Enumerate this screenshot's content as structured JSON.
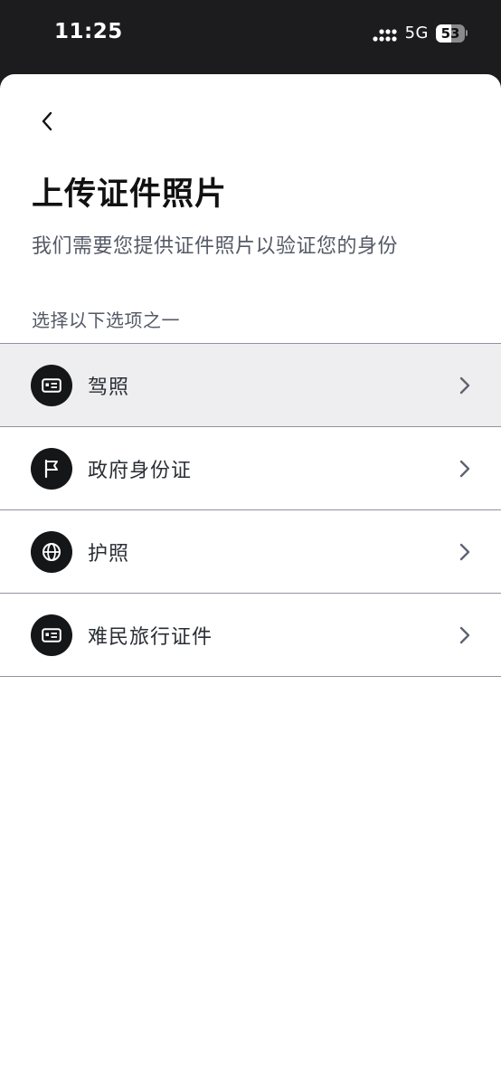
{
  "status_bar": {
    "time": "11:25",
    "network": "5G",
    "battery_level": "53",
    "icons": [
      "signal-icon",
      "battery-icon"
    ]
  },
  "header": {
    "back_icon": "chevron-left-icon",
    "title": "上传证件照片",
    "subtitle": "我们需要您提供证件照片以验证您的身份"
  },
  "options": {
    "section_label": "选择以下选项之一",
    "items": [
      {
        "label": "驾照",
        "icon": "id-card-icon",
        "selected": true
      },
      {
        "label": "政府身份证",
        "icon": "flag-icon",
        "selected": false
      },
      {
        "label": "护照",
        "icon": "globe-icon",
        "selected": false
      },
      {
        "label": "难民旅行证件",
        "icon": "id-card-icon",
        "selected": false
      }
    ],
    "chevron_icon": "chevron-right-icon"
  },
  "colors": {
    "status_bar_bg": "#1c1c1e",
    "title": "#111111",
    "secondary_text": "#545a66",
    "icon_circle": "#141618",
    "divider": "#8f93a0",
    "selected_row_bg": "#eeeef0"
  }
}
